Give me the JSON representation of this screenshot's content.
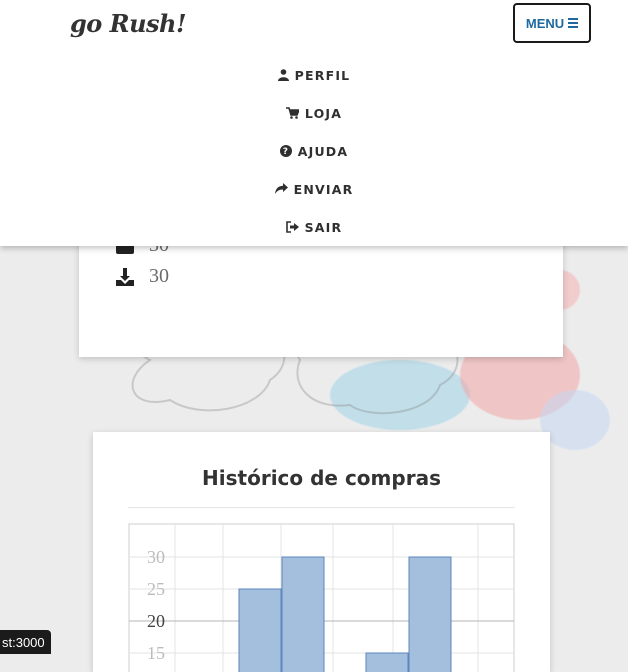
{
  "header": {
    "logo": "go Rush!",
    "menu_label": "MENU"
  },
  "nav": {
    "items": [
      {
        "label": "PERFIL",
        "icon": "user-icon"
      },
      {
        "label": "LOJA",
        "icon": "cart-icon"
      },
      {
        "label": "AJUDA",
        "icon": "question-circle-icon"
      },
      {
        "label": "ENVIAR",
        "icon": "share-icon"
      },
      {
        "label": "SAIR",
        "icon": "sign-out-icon"
      }
    ]
  },
  "stats": {
    "rows": [
      {
        "icon": "inbox-icon",
        "value": "30"
      },
      {
        "icon": "download-icon",
        "value": "30"
      }
    ]
  },
  "chart_data": {
    "type": "bar",
    "title": "Histórico de compras",
    "yticks": [
      "30",
      "25",
      "20",
      "15"
    ],
    "ylim": [
      15,
      30
    ],
    "grid": true,
    "bar_color": "#a3bfdd",
    "bar_stroke": "#5f86b8",
    "values": [
      25,
      30,
      15,
      30
    ]
  },
  "status": {
    "text": "st:3000"
  }
}
